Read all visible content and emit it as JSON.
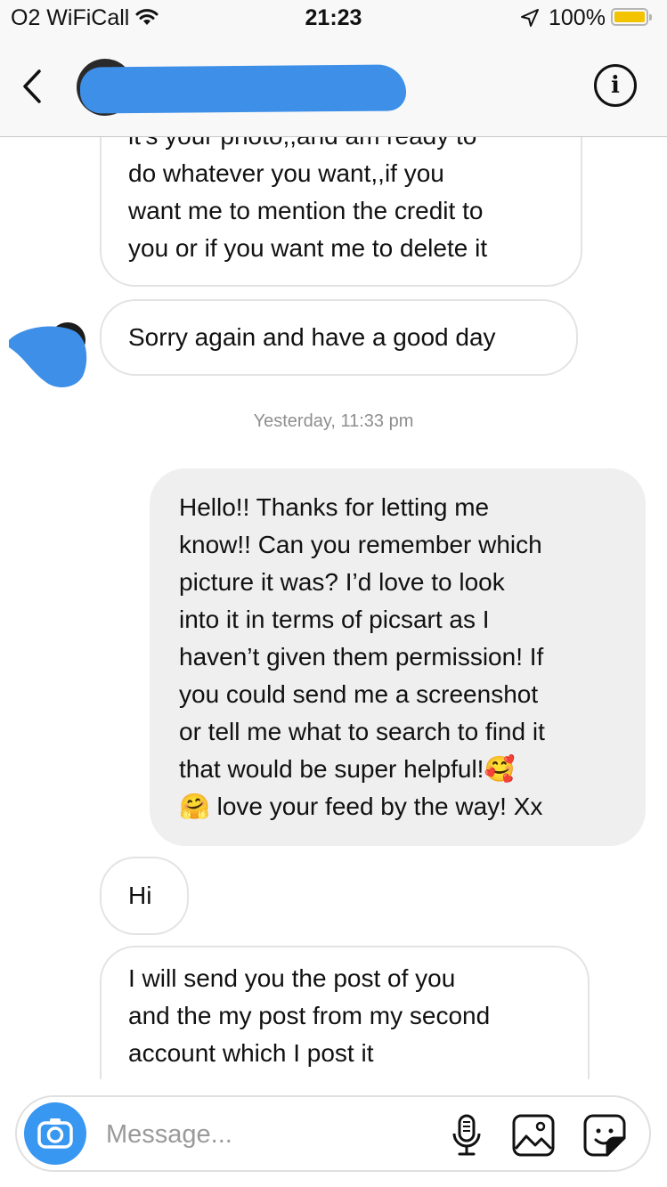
{
  "status_bar": {
    "carrier": "O2 WiFiCall",
    "time": "21:23",
    "battery": "100%",
    "battery_level": 1.0,
    "battery_color": "#f2c400"
  },
  "header": {
    "contact_name": "",
    "back_icon": "chevron-left-icon",
    "info_icon": "info-icon",
    "info_glyph": "i"
  },
  "messages": {
    "m1_lines": [
      "it's your photo,,and am ready to",
      "do whatever you want,,if you",
      "want me to mention the credit to",
      "you or if you want me to delete it"
    ],
    "m2": "Sorry again and have a good day",
    "timestamp": "Yesterday, 11:33 pm",
    "m3_lines": [
      "Hello!! Thanks for letting me",
      "know!! Can you remember which",
      "picture it was? I’d love to look",
      "into it in terms of picsart as I",
      "haven’t given them permission! If",
      "you could send me a screenshot",
      "or tell me what to search to find it",
      "that would be super helpful!🥰",
      "🤗 love your feed by the way! Xx"
    ],
    "m4": "Hi",
    "m5_lines": [
      "I will send you the post of you",
      "and the my post from my second",
      "account which I post it"
    ]
  },
  "composer": {
    "placeholder": "Message...",
    "camera_icon": "camera-icon",
    "mic_icon": "microphone-icon",
    "gallery_icon": "image-icon",
    "sticker_icon": "sticker-icon"
  },
  "colors": {
    "accent": "#3897f0",
    "redaction": "#3d8fe8",
    "outgoing_bubble": "#efefef",
    "incoming_border": "#e3e3e3"
  }
}
